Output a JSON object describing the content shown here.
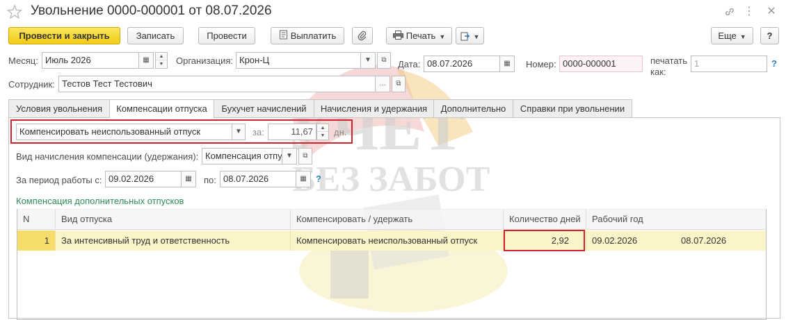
{
  "window": {
    "title": "Увольнение 0000-000001 от 08.07.2026",
    "link_icon": "link-icon",
    "menu_icon": "more-vertical-icon",
    "close_icon": "close-icon"
  },
  "toolbar": {
    "post_close": "Провести и закрыть",
    "save": "Записать",
    "post": "Провести",
    "pay": "Выплатить",
    "print": "Печать",
    "more": "Еще",
    "help": "?"
  },
  "header": {
    "month_label": "Месяц:",
    "month_value": "Июль 2026",
    "org_label": "Организация:",
    "org_value": "Крон-Ц",
    "date_label": "Дата:",
    "date_value": "08.07.2026",
    "number_label": "Номер:",
    "number_value": "0000-000001",
    "print_as_label_1": "печатать",
    "print_as_label_2": "как:",
    "print_as_value": "1",
    "print_as_help": "?",
    "employee_label": "Сотрудник:",
    "employee_value": "Тестов Тест Тестович"
  },
  "tabs": [
    {
      "label": "Условия увольнения"
    },
    {
      "label": "Компенсации отпуска"
    },
    {
      "label": "Бухучет начислений"
    },
    {
      "label": "Начисления и удержания"
    },
    {
      "label": "Дополнительно"
    },
    {
      "label": "Справки при увольнении"
    }
  ],
  "compensation": {
    "mode_value": "Компенсировать неиспользованный отпуск",
    "for_label": "за:",
    "days_value": "11,67",
    "days_unit": "дн.",
    "accrual_label": "Вид начисления компенсации (удержания):",
    "accrual_value": "Компенсация отпу",
    "period_from_label": "За период работы с:",
    "period_from_value": "09.02.2026",
    "period_to_label": "по:",
    "period_to_value": "08.07.2026",
    "period_help": "?",
    "section_title": "Компенсация дополнительных отпусков"
  },
  "table": {
    "columns": [
      "N",
      "Вид отпуска",
      "Компенсировать / удержать",
      "Количество дней",
      "Рабочий год"
    ],
    "rows": [
      {
        "n": "1",
        "type": "За интенсивный труд и ответственность",
        "action": "Компенсировать неиспользованный отпуск",
        "days": "2,92",
        "year_from": "09.02.2026",
        "year_to": "08.07.2026"
      }
    ]
  },
  "watermark": {
    "line1": "УЧЕТ",
    "line2": "БЕЗ ЗАБОТ"
  },
  "colors": {
    "primary_button": "#f1cc16",
    "highlight_border": "#d0222e",
    "section_title": "#2e8b57",
    "selected_row": "#fbf4c8"
  }
}
